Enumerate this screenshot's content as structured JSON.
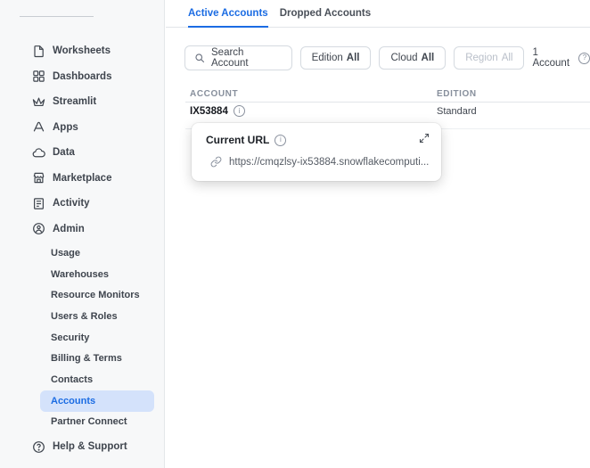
{
  "sidebar": {
    "items": [
      {
        "label": "Worksheets",
        "icon": "worksheets-icon"
      },
      {
        "label": "Dashboards",
        "icon": "dashboards-icon"
      },
      {
        "label": "Streamlit",
        "icon": "streamlit-icon"
      },
      {
        "label": "Apps",
        "icon": "apps-icon"
      },
      {
        "label": "Data",
        "icon": "data-icon"
      },
      {
        "label": "Marketplace",
        "icon": "marketplace-icon"
      },
      {
        "label": "Activity",
        "icon": "activity-icon"
      },
      {
        "label": "Admin",
        "icon": "admin-icon"
      }
    ],
    "admin_subitems": [
      "Usage",
      "Warehouses",
      "Resource Monitors",
      "Users & Roles",
      "Security",
      "Billing & Terms",
      "Contacts",
      "Accounts",
      "Partner Connect"
    ],
    "selected_subitem": "Accounts",
    "help_label": "Help & Support"
  },
  "tabs": [
    {
      "label": "Active Accounts",
      "active": true
    },
    {
      "label": "Dropped Accounts",
      "active": false
    }
  ],
  "toolbar": {
    "search_placeholder": "Search Account",
    "filters": [
      {
        "label": "Edition",
        "value": "All",
        "enabled": true
      },
      {
        "label": "Cloud",
        "value": "All",
        "enabled": true
      },
      {
        "label": "Region",
        "value": "All",
        "enabled": false
      }
    ],
    "count_label": "1 Account"
  },
  "table": {
    "columns": [
      "ACCOUNT",
      "EDITION"
    ],
    "rows": [
      {
        "account": "IX53884",
        "edition": "Standard"
      }
    ]
  },
  "popover": {
    "title": "Current URL",
    "url": "https://cmqzlsy-ix53884.snowflakecomputi..."
  },
  "icons": {
    "info_glyph": "i",
    "question_glyph": "?"
  },
  "colors": {
    "accent": "#1b6ce3",
    "selected_pill_bg": "#d4e2fb",
    "sidebar_bg": "#f7f8f9"
  }
}
